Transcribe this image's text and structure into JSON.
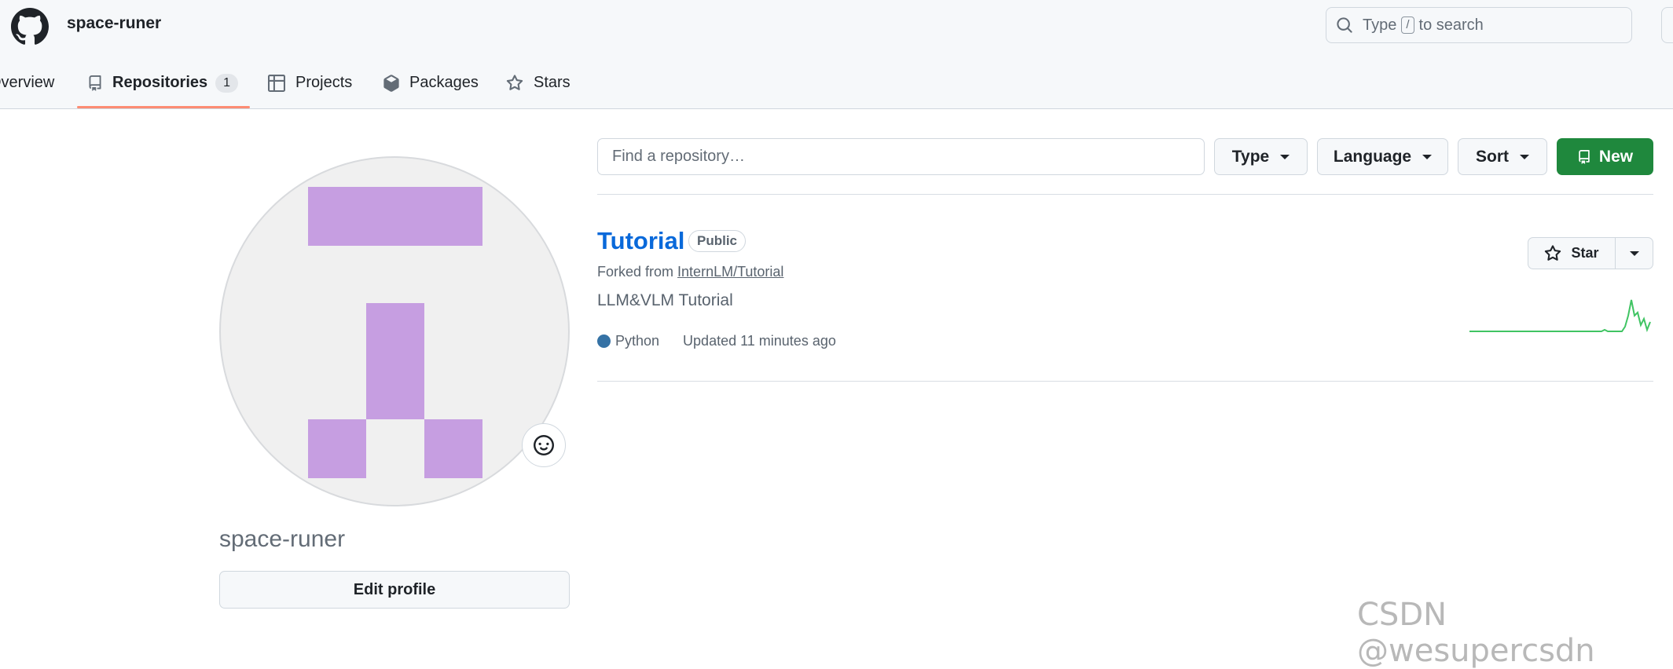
{
  "header": {
    "username": "space-runer",
    "search": {
      "prefix": "Type",
      "key": "/",
      "suffix": "to search"
    }
  },
  "nav": {
    "overview": "Overview",
    "repositories": "Repositories",
    "repositories_count": "1",
    "projects": "Projects",
    "packages": "Packages",
    "stars": "Stars"
  },
  "profile": {
    "name": "space-runer",
    "edit_label": "Edit profile",
    "avatar_color": "#c69ee1"
  },
  "toolbar": {
    "find_placeholder": "Find a repository…",
    "type_label": "Type",
    "language_label": "Language",
    "sort_label": "Sort",
    "new_label": "New"
  },
  "repo": {
    "name": "Tutorial",
    "visibility": "Public",
    "forked_prefix": "Forked from",
    "forked_source": "InternLM/Tutorial",
    "description": "LLM&VLM Tutorial",
    "language": "Python",
    "language_color": "#3572a5",
    "updated": "Updated 11 minutes ago",
    "star_label": "Star"
  },
  "watermark": "CSDN @wesupercsdn"
}
